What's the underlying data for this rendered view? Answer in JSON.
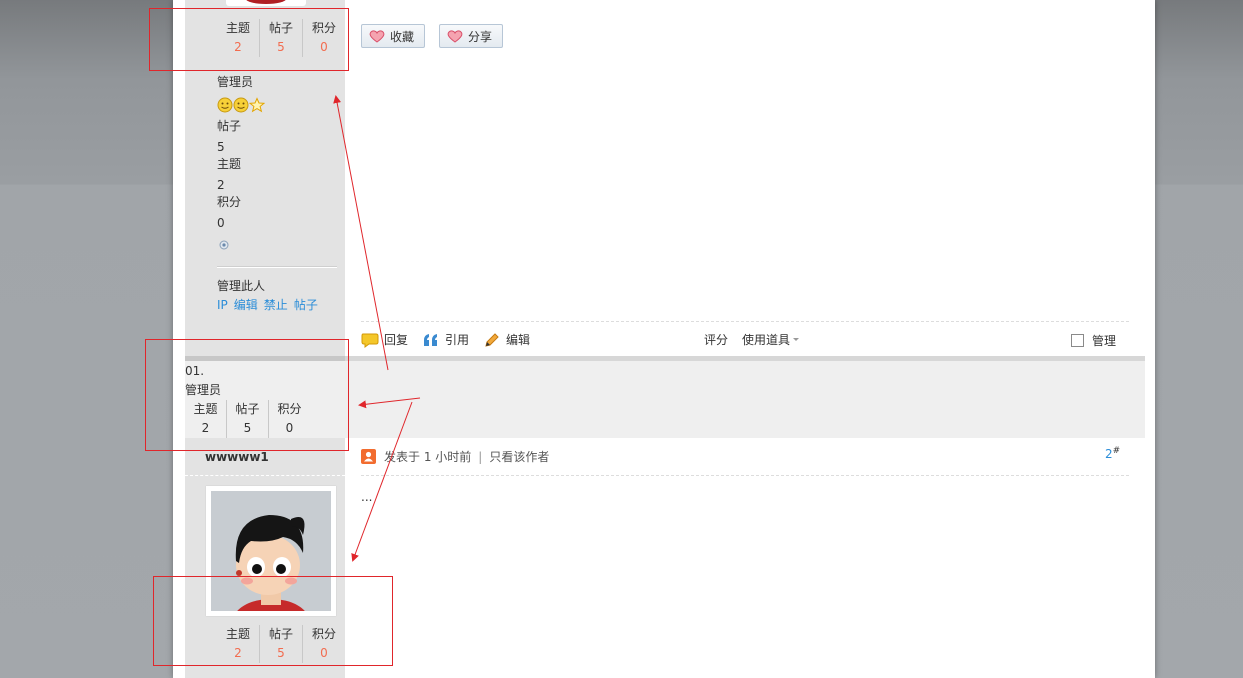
{
  "post1": {
    "stats": [
      {
        "label": "主题",
        "value": "2"
      },
      {
        "label": "帖子",
        "value": "5"
      },
      {
        "label": "积分",
        "value": "0"
      }
    ],
    "group": "管理员",
    "details": {
      "posts_label": "帖子",
      "posts_value": "5",
      "threads_label": "主题",
      "threads_value": "2",
      "credits_label": "积分",
      "credits_value": "0"
    },
    "manage_label": "管理此人",
    "manage_links": [
      "IP",
      "编辑",
      "禁止",
      "帖子"
    ],
    "buttons": {
      "favorite": "收藏",
      "share": "分享"
    },
    "toolbar": {
      "reply": "回复",
      "quote": "引用",
      "edit": "编辑",
      "rate": "评分",
      "use_item": "使用道具",
      "manage": "管理"
    }
  },
  "middle": {
    "index": "01.",
    "group": "管理员",
    "stats": [
      {
        "label": "主题",
        "value": "2"
      },
      {
        "label": "帖子",
        "value": "5"
      },
      {
        "label": "积分",
        "value": "0"
      }
    ]
  },
  "post2": {
    "username": "wwwww1",
    "posted": "发表于 1 小时前",
    "author_only": "只看该作者",
    "floor": "2",
    "floor_sup": "#",
    "content": "...",
    "stats": [
      {
        "label": "主题",
        "value": "2"
      },
      {
        "label": "帖子",
        "value": "5"
      },
      {
        "label": "积分",
        "value": "0"
      }
    ]
  },
  "colors": {
    "accent_orange": "#f26c4f",
    "link_blue": "#2b8dd8",
    "annotation_red": "#e0262b"
  }
}
